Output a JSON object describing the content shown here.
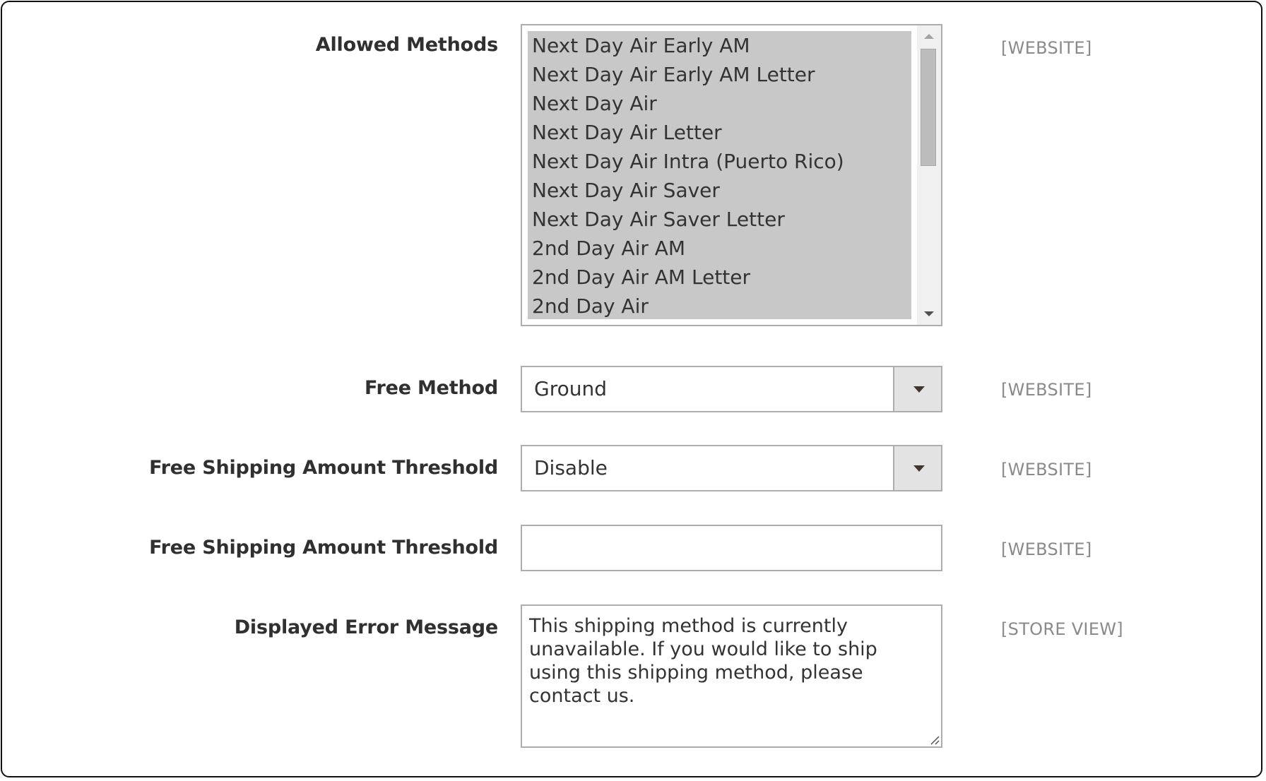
{
  "fields": {
    "allowed_methods": {
      "label": "Allowed Methods",
      "scope": "[WEBSITE]",
      "options": [
        "Next Day Air Early AM",
        "Next Day Air Early AM Letter",
        "Next Day Air",
        "Next Day Air Letter",
        "Next Day Air Intra (Puerto Rico)",
        "Next Day Air Saver",
        "Next Day Air Saver Letter",
        "2nd Day Air AM",
        "2nd Day Air AM Letter",
        "2nd Day Air"
      ]
    },
    "free_method": {
      "label": "Free Method",
      "scope": "[WEBSITE]",
      "value": "Ground"
    },
    "free_shipping_enable": {
      "label": "Free Shipping Amount Threshold",
      "scope": "[WEBSITE]",
      "value": "Disable"
    },
    "free_shipping_amount": {
      "label": "Free Shipping Amount Threshold",
      "scope": "[WEBSITE]",
      "value": "",
      "placeholder": ""
    },
    "error_message": {
      "label": "Displayed Error Message",
      "scope": "[STORE VIEW]",
      "value": "This shipping method is currently unavailable. If you would like to ship using this shipping method, please contact us."
    }
  },
  "icons": {
    "scroll_up": "triangle-up",
    "scroll_down": "triangle-down",
    "select_caret": "triangle-down",
    "resize_grip": "diagonal-lines"
  }
}
